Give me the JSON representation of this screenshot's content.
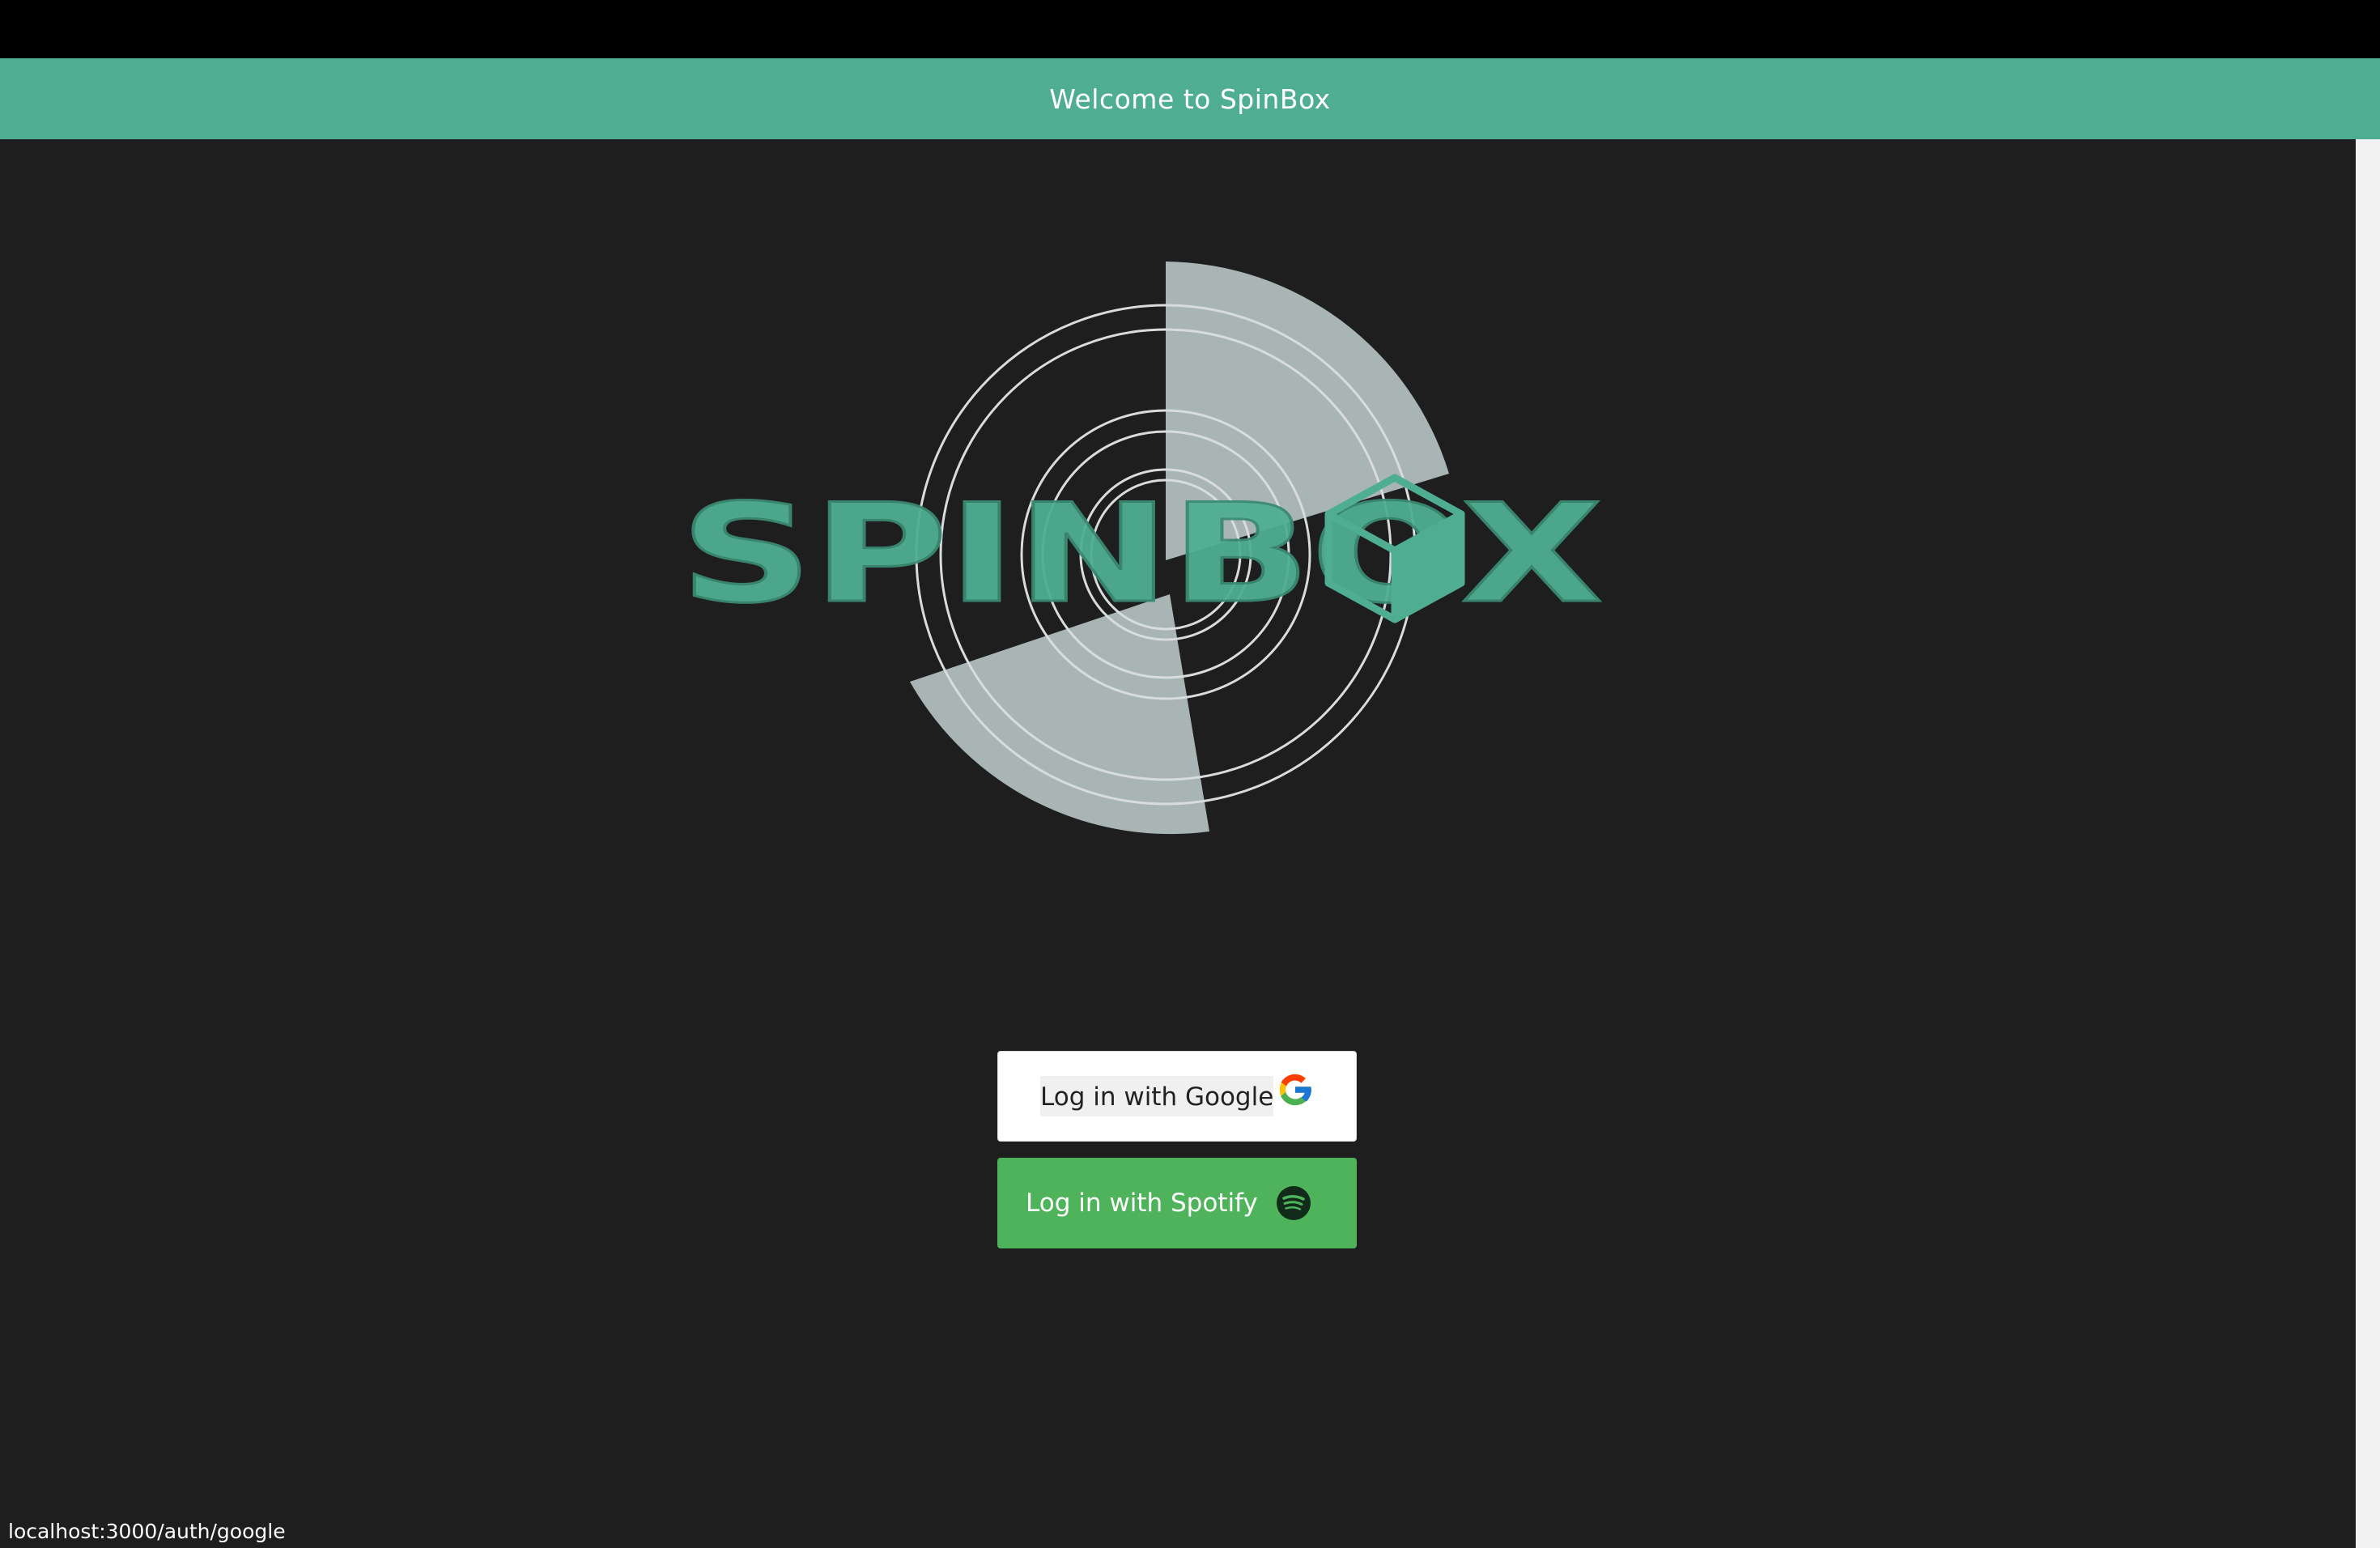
{
  "header": {
    "title": "Welcome to SpinBox"
  },
  "logo": {
    "wordmark": "SPINBOX"
  },
  "buttons": {
    "google_label": "Log in with Google",
    "spotify_label": "Log in with Spotify"
  },
  "status_bar": {
    "url": "localhost:3000/auth/google"
  },
  "colors": {
    "accent": "#4fae92",
    "background": "#1e1e1e",
    "spotify_button": "#4fb35c",
    "logo_disc": "#a9b5b5"
  },
  "icons": {
    "google": "google-g-icon",
    "spotify": "spotify-icon"
  }
}
